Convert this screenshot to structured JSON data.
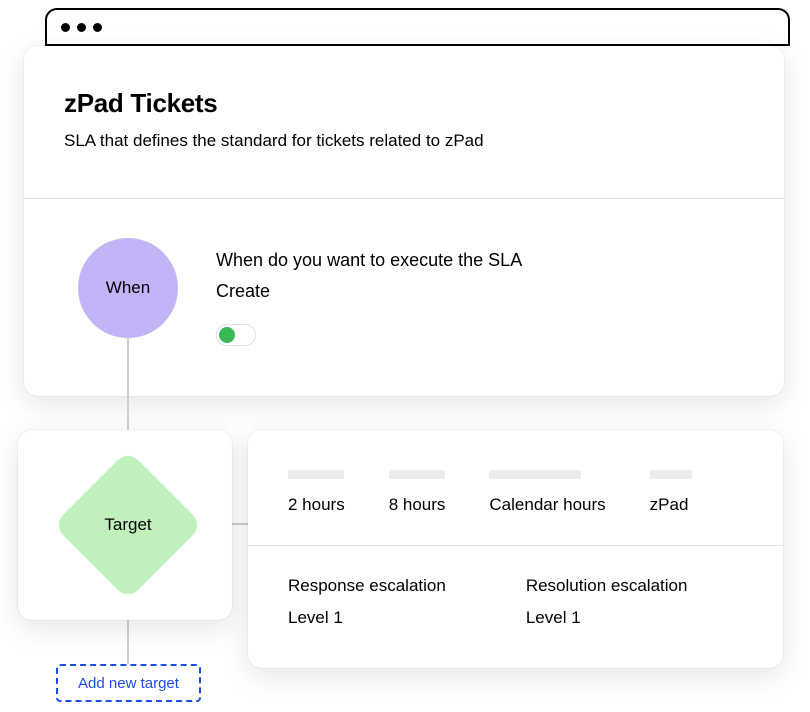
{
  "header": {
    "title": "zPad Tickets",
    "subtitle": "SLA that defines the standard for tickets related to zPad"
  },
  "when": {
    "node_label": "When",
    "question": "When do you want to execute the SLA",
    "value": "Create"
  },
  "target": {
    "node_label": "Target",
    "add_label": "Add new target"
  },
  "detail": {
    "cols": {
      "c1": "2 hours",
      "c2": "8 hours",
      "c3": "Calendar hours",
      "c4": "zPad"
    },
    "response": {
      "title": "Response escalation",
      "level": "Level 1"
    },
    "resolution": {
      "title": "Resolution escalation",
      "level": "Level 1"
    }
  }
}
